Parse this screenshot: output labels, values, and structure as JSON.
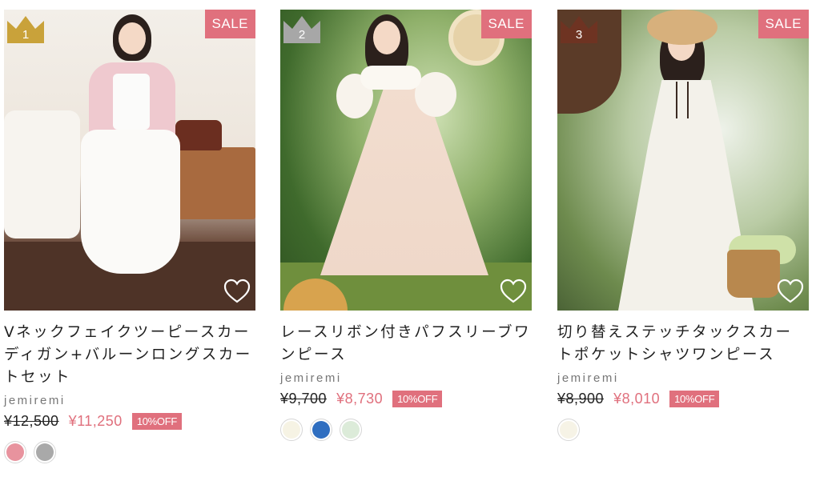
{
  "products": [
    {
      "rank": "1",
      "rank_color": "#c9a23a",
      "sale_label": "SALE",
      "name": "Vネックフェイクツーピースカーディガン+バルーンロングスカートセット",
      "brand": "jemiremi",
      "original_price": "¥12,500",
      "sale_price": "¥11,250",
      "discount": "10%OFF",
      "swatches": [
        "#e8939e",
        "#a9a9a9"
      ]
    },
    {
      "rank": "2",
      "rank_color": "#a7a7a7",
      "sale_label": "SALE",
      "name": "レースリボン付きパフスリーブワンピース",
      "brand": "jemiremi",
      "original_price": "¥9,700",
      "sale_price": "¥8,730",
      "discount": "10%OFF",
      "swatches": [
        "#f6f3e4",
        "#2f6ec0",
        "#dcebd9"
      ]
    },
    {
      "rank": "3",
      "rank_color": "#6e3322",
      "sale_label": "SALE",
      "name": "切り替えステッチタックスカートポケットシャツワンピース",
      "brand": "jemiremi",
      "original_price": "¥8,900",
      "sale_price": "¥8,010",
      "discount": "10%OFF",
      "swatches": [
        "#f6f3e6"
      ]
    }
  ],
  "icons": {
    "favorite": "heart-icon",
    "rank": "crown-icon"
  },
  "colors": {
    "accent": "#e0707d"
  }
}
